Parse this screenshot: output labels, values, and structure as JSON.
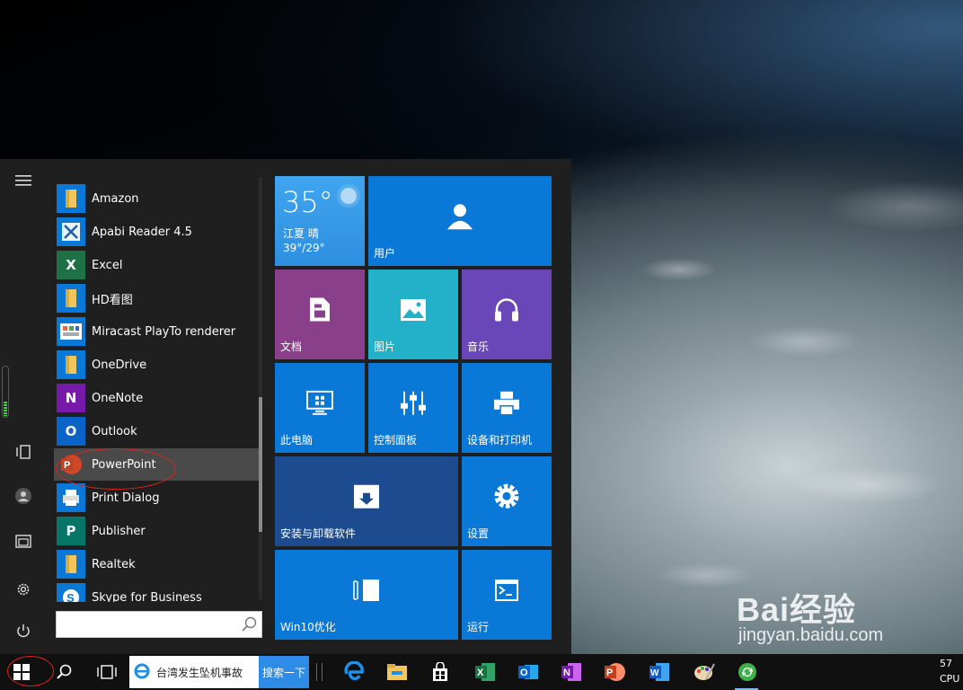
{
  "start_menu": {
    "apps": [
      {
        "label": "Amazon",
        "icon": "folder-icon"
      },
      {
        "label": "Apabi Reader 4.5",
        "icon": "apabi-reader-icon"
      },
      {
        "label": "Excel",
        "icon": "excel-icon"
      },
      {
        "label": "HD看图",
        "icon": "folder-icon"
      },
      {
        "label": "Miracast PlayTo renderer",
        "icon": "miracast-icon"
      },
      {
        "label": "OneDrive",
        "icon": "folder-icon"
      },
      {
        "label": "OneNote",
        "icon": "onenote-icon"
      },
      {
        "label": "Outlook",
        "icon": "outlook-icon"
      },
      {
        "label": "PowerPoint",
        "icon": "powerpoint-icon",
        "selected": true
      },
      {
        "label": "Print Dialog",
        "icon": "print-dialog-icon"
      },
      {
        "label": "Publisher",
        "icon": "publisher-icon"
      },
      {
        "label": "Realtek",
        "icon": "folder-icon"
      },
      {
        "label": "Skype for Business",
        "icon": "skype-icon"
      }
    ],
    "search_placeholder": "",
    "tiles": {
      "weather": {
        "temp": "35°",
        "city": "江夏  晴",
        "range": "39°/29°"
      },
      "user": "用户",
      "documents": "文档",
      "pictures": "图片",
      "music": "音乐",
      "this_pc": "此电脑",
      "control_panel": "控制面板",
      "devices_printers": "设备和打印机",
      "install_uninstall": "安装与卸载软件",
      "settings": "设置",
      "win10_optimize": "Win10优化",
      "run": "运行"
    },
    "tile_colors": {
      "blue": "#0a78d7",
      "purple_docs": "#8a3f8a",
      "teal": "#22b1c9",
      "purple_music": "#6a47b8",
      "dark_blue": "#1d4b8f"
    }
  },
  "taskbar": {
    "browser_search_text": "台湾发生坠机事故",
    "search_button": "搜索一下",
    "clock_line1": "57",
    "clock_line2": "CPU"
  },
  "watermark": {
    "brand": "Bai经验",
    "url": "jingyan.baidu.com"
  }
}
